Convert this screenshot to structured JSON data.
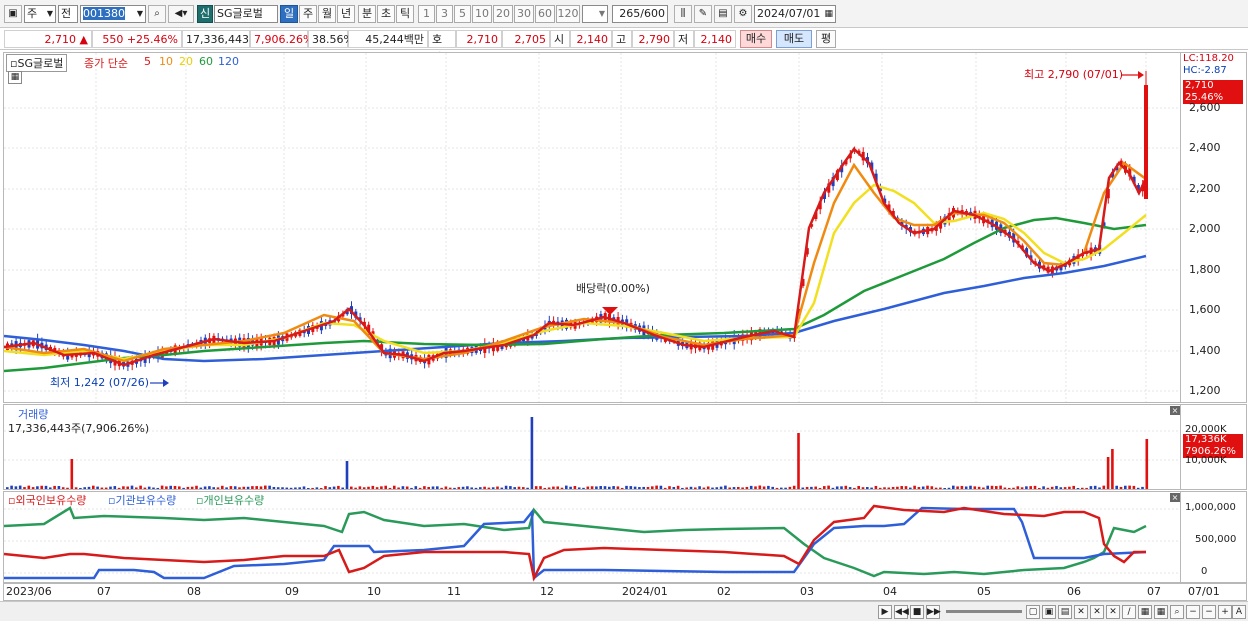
{
  "toolbar": {
    "type_select": "주",
    "market_select": "전",
    "code_value": "001380",
    "badge_new": "신",
    "name_value": "SG글로벌",
    "periods": [
      "일",
      "주",
      "월",
      "년",
      "분",
      "초",
      "틱"
    ],
    "minutes": [
      "1",
      "3",
      "5",
      "10",
      "20",
      "30",
      "60",
      "120"
    ],
    "count_value": "265",
    "count_total": "/600",
    "date_value": "2024/07/01"
  },
  "quote": {
    "price": "2,710",
    "up_symbol": "▲",
    "change": "550",
    "change_pct": "+25.46%",
    "volume": "17,336,443",
    "volume_pct": "7,906.26%",
    "turnover": "38.56%",
    "amount": "45,244백만",
    "ask_label": "호가",
    "bid1": "2,710",
    "bid2": "2,705",
    "open_label": "시",
    "open": "2,140",
    "high_label": "고",
    "high": "2,790",
    "low_label": "저",
    "low": "2,140",
    "buy_label": "매수",
    "sell_label": "매도",
    "eval_label": "평"
  },
  "price_panel": {
    "name_tag": "SG글로벌",
    "legend_prefix": "종가 단순",
    "ma_labels": [
      "5",
      "10",
      "20",
      "60",
      "120"
    ],
    "ma_colors": [
      "#d71a1a",
      "#f08a10",
      "#f2e020",
      "#1f9a3a",
      "#2e5fd8"
    ],
    "lc_label": "LC:118.20",
    "hc_label": "HC:-2.87",
    "price_tag": "2,710",
    "pct_tag": "25.46%",
    "max_label": "최고 2,790 (07/01)",
    "min_label": "최저 1,242 (07/26)",
    "dividend_label": "배당락(0.00%)",
    "y_ticks": [
      "2,600",
      "2,400",
      "2,200",
      "2,000",
      "1,800",
      "1,600",
      "1,400",
      "1,200"
    ]
  },
  "volume_panel": {
    "title": "거래량",
    "value": "17,336,443주(7,906.26%)",
    "y_ticks": [
      "20,000K",
      "10,000K"
    ],
    "tag_value": "17,336K",
    "tag_pct": "7906.26%"
  },
  "holdings_panel": {
    "legends": [
      "외국인보유수량",
      "기관보유수량",
      "개인보유수량"
    ],
    "colors": [
      "#d71a1a",
      "#2e5fd8",
      "#2a9a5a"
    ],
    "y_ticks": [
      "1,000,000",
      "500,000",
      "0"
    ]
  },
  "x_axis": [
    "2023/06",
    "07",
    "08",
    "09",
    "10",
    "11",
    "12",
    "2024/01",
    "02",
    "03",
    "04",
    "05",
    "06",
    "07"
  ],
  "x_axis_right": "07/01",
  "chart_data": [
    {
      "type": "line",
      "title": "SG글로벌",
      "x": [
        "2023/06",
        "07",
        "08",
        "09",
        "10",
        "11",
        "12",
        "2024/01",
        "02",
        "03",
        "04",
        "05",
        "06",
        "07/01"
      ],
      "series": [
        {
          "name": "5",
          "values": [
            1420,
            1390,
            1430,
            1470,
            1560,
            1380,
            1420,
            1560,
            1440,
            1650,
            2340,
            2050,
            2080,
            1800,
            2710
          ]
        },
        {
          "name": "120",
          "values": [
            1460,
            1410,
            1380,
            1390,
            1400,
            1420,
            1430,
            1450,
            1480,
            1500,
            1640,
            1720,
            1770,
            1810,
            1860
          ]
        }
      ],
      "ylim": [
        1150,
        2700
      ]
    },
    {
      "type": "bar",
      "title": "거래량",
      "categories": [
        "07/01"
      ],
      "values": [
        17336443
      ]
    }
  ]
}
